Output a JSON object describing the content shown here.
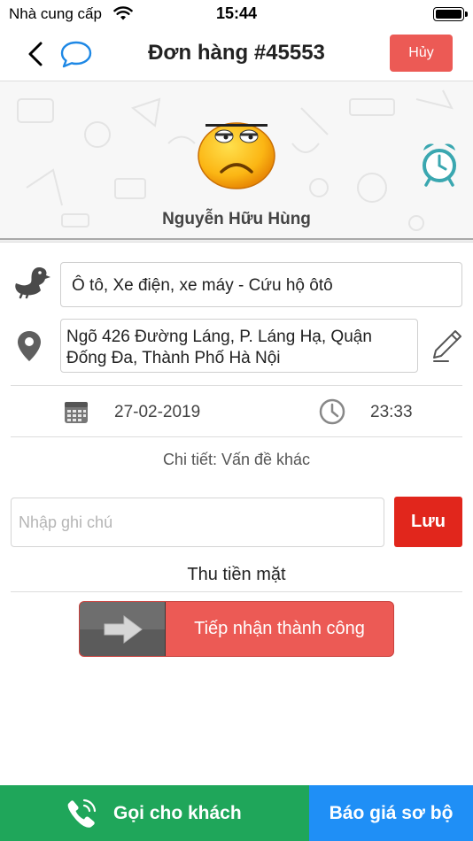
{
  "status_bar": {
    "carrier": "Nhà cung cấp",
    "time": "15:44",
    "battery_level": 1.0
  },
  "header": {
    "title": "Đơn hàng #45553",
    "cancel_label": "Hủy",
    "back_icon": "chevron-left-icon",
    "chat_icon": "chat-bubble-icon"
  },
  "profile": {
    "name": "Nguyễn Hữu Hùng",
    "avatar_icon": "annoyed-face-icon",
    "alarm_icon": "alarm-clock-icon"
  },
  "order": {
    "service": "Ô tô, Xe điện, xe máy - Cứu hộ ôtô",
    "address_line1": "Ngõ 426 Đường Láng, P. Láng Hạ, Quận",
    "address_line2": "Đống Đa, Thành Phố Hà Nội",
    "date": "27-02-2019",
    "time": "23:33",
    "detail": "Chi tiết: Vấn đề khác"
  },
  "note": {
    "placeholder": "Nhập ghi chú",
    "value": "",
    "save_label": "Lưu"
  },
  "payment": "Thu tiền mặt",
  "slider": {
    "label": "Tiếp nhận thành công"
  },
  "bottom_bar": {
    "call_label": "Gọi cho khách",
    "quote_label": "Báo giá sơ bộ"
  },
  "colors": {
    "accent_red": "#ec5a55",
    "save_red": "#e1261c",
    "call_green": "#1fa65a",
    "quote_blue": "#1f8ff6",
    "chat_blue": "#1e88e5",
    "alarm_teal": "#3aa7b0"
  }
}
